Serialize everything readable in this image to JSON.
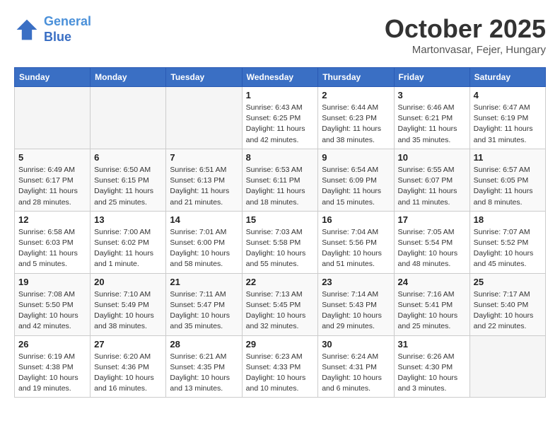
{
  "header": {
    "logo_line1": "General",
    "logo_line2": "Blue",
    "month": "October 2025",
    "location": "Martonvasar, Fejer, Hungary"
  },
  "weekdays": [
    "Sunday",
    "Monday",
    "Tuesday",
    "Wednesday",
    "Thursday",
    "Friday",
    "Saturday"
  ],
  "weeks": [
    [
      {
        "day": "",
        "info": ""
      },
      {
        "day": "",
        "info": ""
      },
      {
        "day": "",
        "info": ""
      },
      {
        "day": "1",
        "info": "Sunrise: 6:43 AM\nSunset: 6:25 PM\nDaylight: 11 hours\nand 42 minutes."
      },
      {
        "day": "2",
        "info": "Sunrise: 6:44 AM\nSunset: 6:23 PM\nDaylight: 11 hours\nand 38 minutes."
      },
      {
        "day": "3",
        "info": "Sunrise: 6:46 AM\nSunset: 6:21 PM\nDaylight: 11 hours\nand 35 minutes."
      },
      {
        "day": "4",
        "info": "Sunrise: 6:47 AM\nSunset: 6:19 PM\nDaylight: 11 hours\nand 31 minutes."
      }
    ],
    [
      {
        "day": "5",
        "info": "Sunrise: 6:49 AM\nSunset: 6:17 PM\nDaylight: 11 hours\nand 28 minutes."
      },
      {
        "day": "6",
        "info": "Sunrise: 6:50 AM\nSunset: 6:15 PM\nDaylight: 11 hours\nand 25 minutes."
      },
      {
        "day": "7",
        "info": "Sunrise: 6:51 AM\nSunset: 6:13 PM\nDaylight: 11 hours\nand 21 minutes."
      },
      {
        "day": "8",
        "info": "Sunrise: 6:53 AM\nSunset: 6:11 PM\nDaylight: 11 hours\nand 18 minutes."
      },
      {
        "day": "9",
        "info": "Sunrise: 6:54 AM\nSunset: 6:09 PM\nDaylight: 11 hours\nand 15 minutes."
      },
      {
        "day": "10",
        "info": "Sunrise: 6:55 AM\nSunset: 6:07 PM\nDaylight: 11 hours\nand 11 minutes."
      },
      {
        "day": "11",
        "info": "Sunrise: 6:57 AM\nSunset: 6:05 PM\nDaylight: 11 hours\nand 8 minutes."
      }
    ],
    [
      {
        "day": "12",
        "info": "Sunrise: 6:58 AM\nSunset: 6:03 PM\nDaylight: 11 hours\nand 5 minutes."
      },
      {
        "day": "13",
        "info": "Sunrise: 7:00 AM\nSunset: 6:02 PM\nDaylight: 11 hours\nand 1 minute."
      },
      {
        "day": "14",
        "info": "Sunrise: 7:01 AM\nSunset: 6:00 PM\nDaylight: 10 hours\nand 58 minutes."
      },
      {
        "day": "15",
        "info": "Sunrise: 7:03 AM\nSunset: 5:58 PM\nDaylight: 10 hours\nand 55 minutes."
      },
      {
        "day": "16",
        "info": "Sunrise: 7:04 AM\nSunset: 5:56 PM\nDaylight: 10 hours\nand 51 minutes."
      },
      {
        "day": "17",
        "info": "Sunrise: 7:05 AM\nSunset: 5:54 PM\nDaylight: 10 hours\nand 48 minutes."
      },
      {
        "day": "18",
        "info": "Sunrise: 7:07 AM\nSunset: 5:52 PM\nDaylight: 10 hours\nand 45 minutes."
      }
    ],
    [
      {
        "day": "19",
        "info": "Sunrise: 7:08 AM\nSunset: 5:50 PM\nDaylight: 10 hours\nand 42 minutes."
      },
      {
        "day": "20",
        "info": "Sunrise: 7:10 AM\nSunset: 5:49 PM\nDaylight: 10 hours\nand 38 minutes."
      },
      {
        "day": "21",
        "info": "Sunrise: 7:11 AM\nSunset: 5:47 PM\nDaylight: 10 hours\nand 35 minutes."
      },
      {
        "day": "22",
        "info": "Sunrise: 7:13 AM\nSunset: 5:45 PM\nDaylight: 10 hours\nand 32 minutes."
      },
      {
        "day": "23",
        "info": "Sunrise: 7:14 AM\nSunset: 5:43 PM\nDaylight: 10 hours\nand 29 minutes."
      },
      {
        "day": "24",
        "info": "Sunrise: 7:16 AM\nSunset: 5:41 PM\nDaylight: 10 hours\nand 25 minutes."
      },
      {
        "day": "25",
        "info": "Sunrise: 7:17 AM\nSunset: 5:40 PM\nDaylight: 10 hours\nand 22 minutes."
      }
    ],
    [
      {
        "day": "26",
        "info": "Sunrise: 6:19 AM\nSunset: 4:38 PM\nDaylight: 10 hours\nand 19 minutes."
      },
      {
        "day": "27",
        "info": "Sunrise: 6:20 AM\nSunset: 4:36 PM\nDaylight: 10 hours\nand 16 minutes."
      },
      {
        "day": "28",
        "info": "Sunrise: 6:21 AM\nSunset: 4:35 PM\nDaylight: 10 hours\nand 13 minutes."
      },
      {
        "day": "29",
        "info": "Sunrise: 6:23 AM\nSunset: 4:33 PM\nDaylight: 10 hours\nand 10 minutes."
      },
      {
        "day": "30",
        "info": "Sunrise: 6:24 AM\nSunset: 4:31 PM\nDaylight: 10 hours\nand 6 minutes."
      },
      {
        "day": "31",
        "info": "Sunrise: 6:26 AM\nSunset: 4:30 PM\nDaylight: 10 hours\nand 3 minutes."
      },
      {
        "day": "",
        "info": ""
      }
    ]
  ]
}
